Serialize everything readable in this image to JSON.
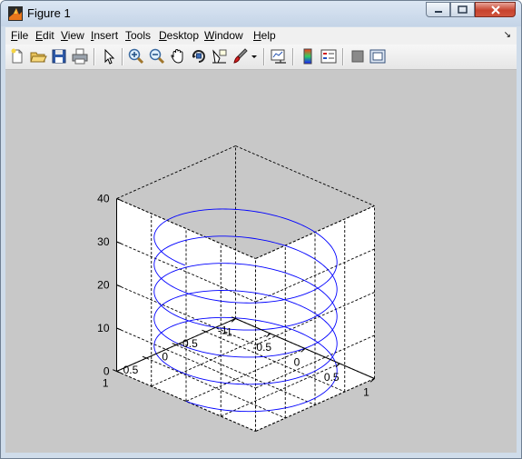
{
  "window": {
    "title": "Figure 1"
  },
  "menu": [
    {
      "accel": "F",
      "rest": "ile"
    },
    {
      "accel": "E",
      "rest": "dit"
    },
    {
      "accel": "V",
      "rest": "iew"
    },
    {
      "accel": "I",
      "rest": "nsert"
    },
    {
      "accel": "T",
      "rest": "ools"
    },
    {
      "accel": "D",
      "rest": "esktop"
    },
    {
      "accel": "W",
      "rest": "indow"
    },
    {
      "accel": "H",
      "rest": "elp"
    }
  ],
  "toolbar_icons": [
    "new-figure-icon",
    "open-file-icon",
    "save-icon",
    "print-icon",
    "edit-plot-arrow-icon",
    "zoom-in-icon",
    "zoom-out-icon",
    "pan-hand-icon",
    "rotate-3d-icon",
    "data-cursor-icon",
    "brush-icon",
    "brush-dropdown-icon",
    "link-plot-icon",
    "colorbar-icon",
    "legend-icon",
    "hide-plot-tools-icon",
    "show-plot-tools-icon"
  ],
  "chart_data": {
    "type": "line3d",
    "description_visible": "helix plot3(sin t, cos t, t)",
    "x_ticks": [
      "-1",
      "-0.5",
      "0",
      "0.5",
      "1"
    ],
    "y_ticks": [
      "-1",
      "-0.5",
      "0",
      "0.5",
      "1"
    ],
    "z_ticks": [
      "0",
      "10",
      "20",
      "30",
      "40"
    ],
    "xlim": [
      -1,
      1
    ],
    "ylim": [
      -1,
      1
    ],
    "zlim": [
      0,
      40
    ],
    "t_range": [
      0,
      31.4
    ],
    "grid": true,
    "box": true,
    "line_color": "#0000ff"
  }
}
